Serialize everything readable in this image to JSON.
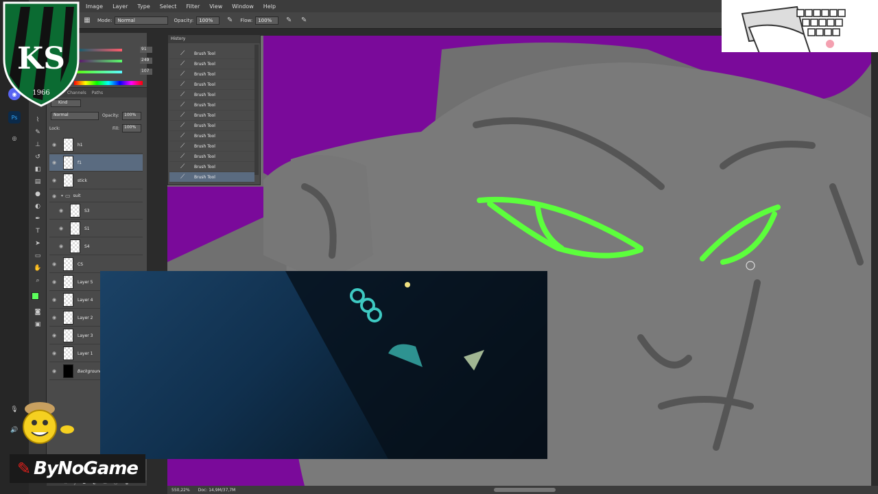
{
  "app": {
    "name": "Ps"
  },
  "menubar": {
    "items": [
      "Image",
      "Layer",
      "Type",
      "Select",
      "Filter",
      "View",
      "Window",
      "Help"
    ]
  },
  "options": {
    "mode_label": "Mode:",
    "mode_value": "Normal",
    "opacity_label": "Opacity:",
    "opacity_value": "100%",
    "flow_label": "Flow:",
    "flow_value": "100%"
  },
  "color_panel": {
    "values": [
      "91",
      "249",
      "107"
    ],
    "foreground": "#5cff5c"
  },
  "layers_panel": {
    "tabs": [
      "Channels",
      "Paths"
    ],
    "kind_label": "Kind",
    "blend_mode": "Normal",
    "opacity_label": "Opacity:",
    "opacity_value": "100%",
    "lock_label": "Lock:",
    "fill_label": "Fill:",
    "fill_value": "100%",
    "layers": [
      {
        "name": "h1"
      },
      {
        "name": "f1",
        "selected": true
      },
      {
        "name": "stick"
      },
      {
        "name": "suit"
      },
      {
        "name": "S3"
      },
      {
        "name": "S1"
      },
      {
        "name": "S4"
      },
      {
        "name": "CS"
      },
      {
        "name": "Layer 5"
      },
      {
        "name": "Layer 4"
      },
      {
        "name": "Layer 2"
      },
      {
        "name": "Layer 3"
      },
      {
        "name": "Layer 1"
      },
      {
        "name": "Background"
      }
    ]
  },
  "history_panel": {
    "title": "History",
    "items": [
      "Brush Tool",
      "Brush Tool",
      "Brush Tool",
      "Brush Tool",
      "Brush Tool",
      "Brush Tool",
      "Brush Tool",
      "Brush Tool",
      "Brush Tool",
      "Brush Tool",
      "Brush Tool",
      "Brush Tool",
      "Brush Tool"
    ]
  },
  "statusbar": {
    "zoom": "550,22%",
    "doc": "Doc: 14,9M/37,7M"
  },
  "overlay": {
    "logo_year": "1966",
    "logo_letters": "KS",
    "brand": "ByNoGame"
  },
  "colors": {
    "canvas_bg": "#7a0a9a",
    "face": "#707070",
    "eye_glow": "#5cff3c",
    "panel": "#4a4a4a",
    "selected": "#5a6b80"
  }
}
